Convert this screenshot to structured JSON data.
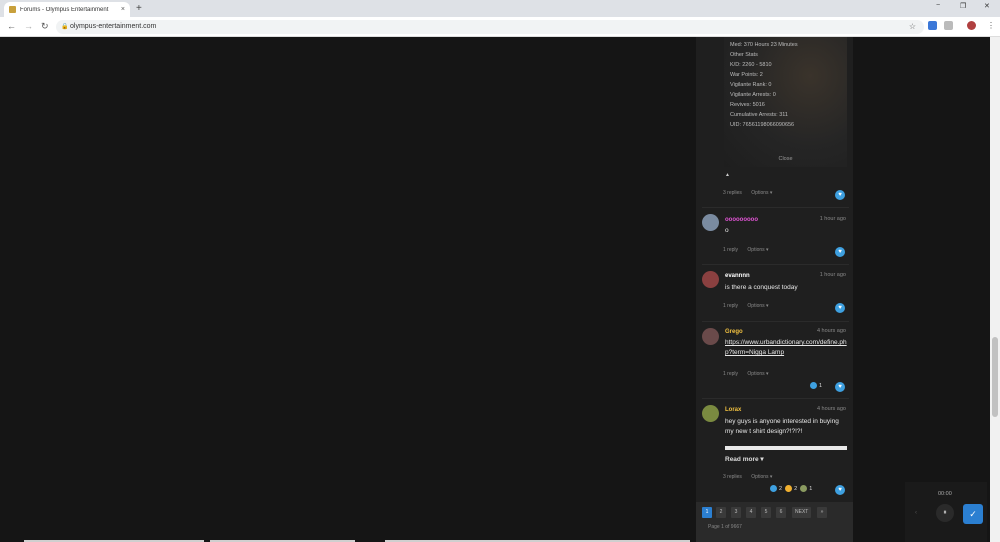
{
  "browser": {
    "tab_title": "Forums - Olympus Entertainment",
    "tab_close": "×",
    "new_tab": "+",
    "url": "olympus-entertainment.com",
    "back": "←",
    "forward": "→",
    "reload": "↻",
    "star": "☆",
    "minimize": "−",
    "maximize": "❐",
    "close": "✕",
    "menu": "⋮"
  },
  "profile_card": {
    "lines": [
      "Med: 370 Hours 23 Minutes",
      "Other Stats",
      "K/D: 2260 - 5810",
      "War Points: 2",
      "Vigilante Rank: 0",
      "Vigilante Arrests: 0",
      "Revives: 5016",
      "Cumulative Arrests: 311",
      "UID: 76561198066090656"
    ],
    "close_label": "Close",
    "caret": "▲"
  },
  "feed": {
    "first_meta": {
      "replies": "3 replies",
      "options": "Options ▾"
    },
    "posts": [
      {
        "username": "ooooooooo",
        "name_color": "#e255d6",
        "time": "1 hour ago",
        "text": "o",
        "replies": "1 reply",
        "options": "Options ▾",
        "avatar_color": "#7a8ba0"
      },
      {
        "username": "evannnn",
        "name_color": "#ffffff",
        "time": "1 hour ago",
        "text": "is there a conquest today",
        "replies": "1 reply",
        "options": "Options ▾",
        "avatar_color": "#8a4040"
      },
      {
        "username": "Grego",
        "name_color": "#f0c040",
        "time": "4 hours ago",
        "link": "https://www.urbandictionary.com/define.php?term=Nigga Lamp",
        "replies": "1 reply",
        "options": "Options ▾",
        "reaction_count": "1",
        "avatar_color": "#6a4a4a"
      },
      {
        "username": "Lorax",
        "name_color": "#f0c040",
        "time": "4 hours ago",
        "text": "hey guys is anyone interested in buying my new t shirt design?!?!?!",
        "read_more": "Read more ▾",
        "replies": "3 replies",
        "options": "Options ▾",
        "reactions": [
          {
            "count": "2",
            "color": "#3ea0e0"
          },
          {
            "count": "2",
            "color": "#f0b030"
          },
          {
            "count": "1",
            "color": "#8a9a60"
          }
        ],
        "avatar_color": "#7a8a40"
      }
    ],
    "like_icon": "♥"
  },
  "pagination": {
    "pages": [
      "1",
      "2",
      "3",
      "4",
      "5",
      "6"
    ],
    "next": "NEXT",
    "last": "»",
    "info": "Page 1 of 9667"
  },
  "media_widget": {
    "time": "00:00",
    "pause": "⏸",
    "prev": "‹",
    "check": "✓"
  }
}
